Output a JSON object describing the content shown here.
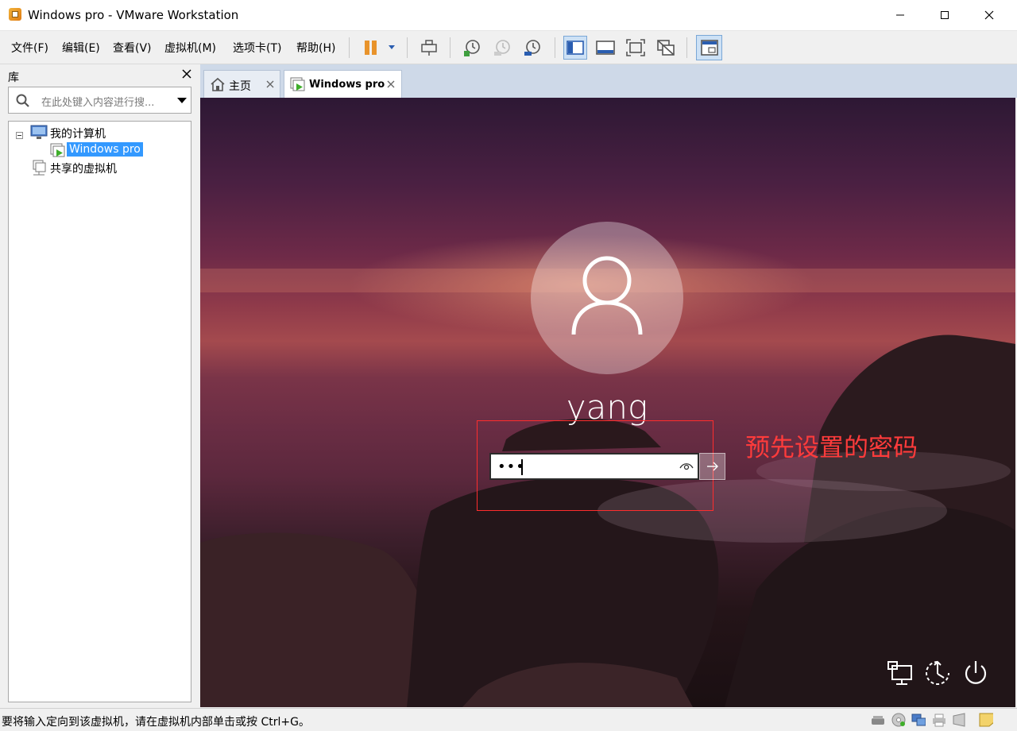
{
  "window": {
    "title": "Windows pro - VMware Workstation"
  },
  "menu": {
    "items": [
      "文件(F)",
      "编辑(E)",
      "查看(V)",
      "虚拟机(M)",
      "选项卡(T)",
      "帮助(H)"
    ]
  },
  "toolbar": {
    "buttons": [
      "pause-vm",
      "send-ctrl-alt-del",
      "take-snapshot",
      "revert-snapshot",
      "snapshot-manager",
      "show-library",
      "show-thumbnail-bar",
      "full-screen",
      "unity",
      "console-view"
    ],
    "active": [
      "show-library",
      "console-view"
    ]
  },
  "library": {
    "title": "库",
    "search_placeholder": "在此处键入内容进行搜...",
    "tree": {
      "root": "我的计算机",
      "vm": "Windows pro",
      "shared": "共享的虚拟机"
    }
  },
  "tabs": [
    {
      "label": "主页",
      "active": false
    },
    {
      "label": "Windows pro",
      "active": true
    }
  ],
  "vm_screen": {
    "username": "yang",
    "password_masked": "•••",
    "annotation": "预先设置的密码",
    "annotation_color": "#ff3b3b",
    "bottom_icons": [
      "network-icon",
      "accessibility-icon",
      "power-icon"
    ]
  },
  "status": {
    "text": "要将输入定向到该虚拟机，请在虚拟机内部单击或按 Ctrl+G。"
  },
  "colors": {
    "selection": "#3399ff",
    "tabbar": "#ced9e8"
  }
}
